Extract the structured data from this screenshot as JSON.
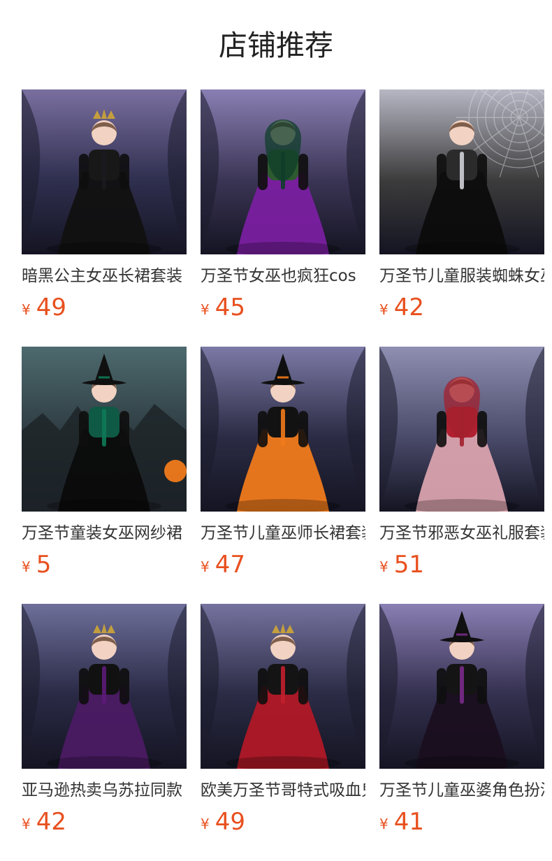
{
  "section": {
    "title": "店铺推荐"
  },
  "products": [
    {
      "name": "暗黑公主女巫长裙套装",
      "currency": "¥",
      "price": "49",
      "image": {
        "scene": "dark-gothic-room",
        "bg": "#2f2f4f",
        "accent": "#1a1a1f",
        "dress": "#111111",
        "top": "#181818",
        "hat": "crown",
        "glow": "#7a6fa0"
      }
    },
    {
      "name": "万圣节女巫也疯狂cos",
      "currency": "¥",
      "price": "45",
      "image": {
        "scene": "purple-curtains",
        "bg": "#3b3555",
        "accent": "#0f3d2a",
        "dress": "#7a1fa0",
        "top": "#2d5a2f",
        "hat": "hood",
        "glow": "#8a7fb3"
      }
    },
    {
      "name": "万圣节儿童服装蜘蛛女巫",
      "currency": "¥",
      "price": "42",
      "image": {
        "scene": "spiderweb",
        "bg": "#3c3c3c",
        "accent": "#cfcfd6",
        "dress": "#0c0c0c",
        "top": "#2b2b2b",
        "hat": "none",
        "glow": "#b7b7c4"
      }
    },
    {
      "name": "万圣节童装女巫网纱裙",
      "currency": "¥",
      "price": "5",
      "image": {
        "scene": "teal-castle",
        "bg": "#2d3a40",
        "accent": "#0e7a57",
        "dress": "#0b0b0b",
        "top": "#0f5a44",
        "hat": "witch",
        "glow": "#4d6a6e"
      }
    },
    {
      "name": "万圣节儿童巫师长裙套装",
      "currency": "¥",
      "price": "47",
      "image": {
        "scene": "purple-curtains",
        "bg": "#2b2b44",
        "accent": "#f07a1b",
        "dress": "#f07a1b",
        "top": "#121212",
        "hat": "witch",
        "glow": "#7c7aa6"
      }
    },
    {
      "name": "万圣节邪恶女巫礼服套装",
      "currency": "¥",
      "price": "51",
      "image": {
        "scene": "purple-cloudy",
        "bg": "#4a4a6a",
        "accent": "#a3202e",
        "dress": "#d9a2ad",
        "top": "#b02030",
        "hat": "hood",
        "glow": "#8f8fb2"
      }
    },
    {
      "name": "亚马逊热卖乌苏拉同款",
      "currency": "¥",
      "price": "42",
      "image": {
        "scene": "dark-gothic-room",
        "bg": "#2a2a46",
        "accent": "#5d1a78",
        "dress": "#4b1a63",
        "top": "#111111",
        "hat": "crown",
        "glow": "#6e6f9a"
      }
    },
    {
      "name": "欧美万圣节哥特式吸血鬼",
      "currency": "¥",
      "price": "49",
      "image": {
        "scene": "dark-gothic-room",
        "bg": "#2b2b45",
        "accent": "#c21f2e",
        "dress": "#b01826",
        "top": "#141414",
        "hat": "crown",
        "glow": "#75739f"
      }
    },
    {
      "name": "万圣节儿童巫婆角色扮演",
      "currency": "¥",
      "price": "41",
      "image": {
        "scene": "purple-curtains",
        "bg": "#34304f",
        "accent": "#7a2b8a",
        "dress": "#1a0f1f",
        "top": "#141414",
        "hat": "witch",
        "glow": "#8a7fb3"
      }
    }
  ]
}
